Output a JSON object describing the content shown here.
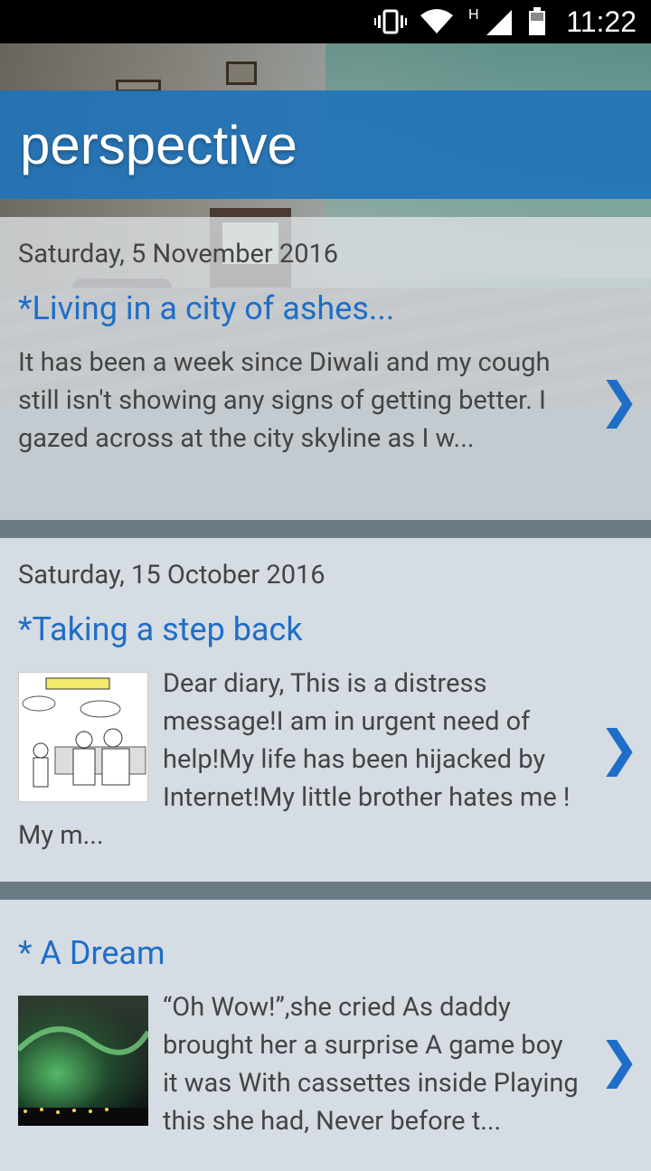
{
  "status": {
    "time": "11:22",
    "network_label": "H"
  },
  "blog": {
    "title": "perspective"
  },
  "posts": [
    {
      "date": "Saturday, 5 November 2016",
      "title": "*Living in a city of ashes...",
      "excerpt": "It has been a week since Diwali and my cough still isn't showing any signs of getting better. I gazed across at the city skyline as I w...",
      "thumbnail": null
    },
    {
      "date": "Saturday, 15 October 2016",
      "title": "*Taking a step back",
      "excerpt": "Dear diary, This is a distress message!I am in urgent need of help!My life has been hijacked by Internet!My little brother hates me ! My m...",
      "thumbnail": "cartoon"
    },
    {
      "date": "",
      "title": "* A Dream",
      "excerpt": "“Oh Wow!”,she cried As daddy brought her a surprise A game boy it was With cassettes inside Playing this she had, Never before t...",
      "thumbnail": "aurora"
    }
  ],
  "icons": {
    "chevron": "chevron-right-icon",
    "vibrate": "vibrate-icon",
    "wifi": "wifi-icon",
    "signal": "signal-icon",
    "battery": "battery-icon"
  },
  "colors": {
    "appbar": "#2173b9",
    "link": "#1e6ec8",
    "divider": "#6b7b86"
  }
}
